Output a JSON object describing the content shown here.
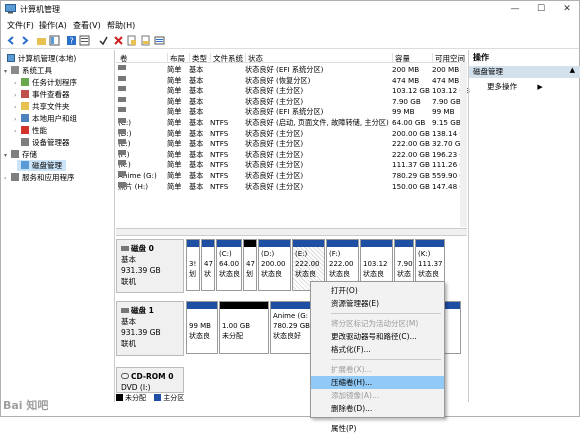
{
  "window": {
    "title": "计算机管理",
    "minimize": "—",
    "maximize": "☐",
    "close": "✕"
  },
  "menu": [
    "文件(F)",
    "操作(A)",
    "查看(V)",
    "帮助(H)"
  ],
  "tree": [
    {
      "label": "计算机管理(本地)",
      "level": 0,
      "arrow": "",
      "icon": "computer-icon"
    },
    {
      "label": "系统工具",
      "level": 1,
      "arrow": "▾",
      "icon": "tools-icon"
    },
    {
      "label": "任务计划程序",
      "level": 2,
      "arrow": "›",
      "icon": "task-scheduler-icon"
    },
    {
      "label": "事件查看器",
      "level": 2,
      "arrow": "›",
      "icon": "event-viewer-icon"
    },
    {
      "label": "共享文件夹",
      "level": 2,
      "arrow": "›",
      "icon": "shared-folder-icon"
    },
    {
      "label": "本地用户和组",
      "level": 2,
      "arrow": "›",
      "icon": "users-icon"
    },
    {
      "label": "性能",
      "level": 2,
      "arrow": "›",
      "icon": "performance-icon"
    },
    {
      "label": "设备管理器",
      "level": 2,
      "arrow": "",
      "icon": "device-manager-icon"
    },
    {
      "label": "存储",
      "level": 1,
      "arrow": "▾",
      "icon": "storage-icon"
    },
    {
      "label": "磁盘管理",
      "level": 2,
      "arrow": "",
      "icon": "disk-management-icon",
      "selected": true
    },
    {
      "label": "服务和应用程序",
      "level": 1,
      "arrow": "›",
      "icon": "services-icon"
    }
  ],
  "columns": [
    "卷",
    "布局",
    "类型",
    "文件系统",
    "状态",
    "容量",
    "可用空间"
  ],
  "volumes": [
    [
      "",
      "简单",
      "基本",
      "",
      "状态良好 (EFI 系统分区)",
      "200 MB",
      "200 MB"
    ],
    [
      "",
      "简单",
      "基本",
      "",
      "状态良好 (恢复分区)",
      "474 MB",
      "474 MB"
    ],
    [
      "",
      "简单",
      "基本",
      "",
      "状态良好 (主分区)",
      "103.12 GB",
      "103.12 GB"
    ],
    [
      "",
      "简单",
      "基本",
      "",
      "状态良好 (主分区)",
      "7.90 GB",
      "7.90 GB"
    ],
    [
      "",
      "简单",
      "基本",
      "",
      "状态良好 (EFI 系统分区)",
      "99 MB",
      "99 MB"
    ],
    [
      "(C:)",
      "简单",
      "基本",
      "NTFS",
      "状态良好 (启动, 页面文件, 故障转储, 主分区)",
      "64.00 GB",
      "9.15 GB"
    ],
    [
      "(D:)",
      "简单",
      "基本",
      "NTFS",
      "状态良好 (主分区)",
      "200.00 GB",
      "138.14 G"
    ],
    [
      "(E:)",
      "简单",
      "基本",
      "NTFS",
      "状态良好 (主分区)",
      "222.00 GB",
      "32.70 GB"
    ],
    [
      "(F:)",
      "简单",
      "基本",
      "NTFS",
      "状态良好 (主分区)",
      "222.00 GB",
      "196.23 G"
    ],
    [
      "(K:)",
      "简单",
      "基本",
      "NTFS",
      "状态良好 (主分区)",
      "111.37 GB",
      "111.26 G"
    ],
    [
      "Anime (G:)",
      "简单",
      "基本",
      "NTFS",
      "状态良好 (主分区)",
      "780.29 GB",
      "559.90 G"
    ],
    [
      "照片 (H:)",
      "简单",
      "基本",
      "NTFS",
      "状态良好 (主分区)",
      "150.00 GB",
      "147.48 G"
    ]
  ],
  "disks": [
    {
      "name": "磁盘 0",
      "type": "基本",
      "size": "931.39 GB",
      "state": "联机",
      "partitions": [
        {
          "l1": "",
          "l2": "3!",
          "l3": "划"
        },
        {
          "l1": "",
          "l2": "47",
          "l3": "状"
        },
        {
          "l1": "(C:)",
          "l2": "64.00",
          "l3": "状态良"
        },
        {
          "l1": "",
          "l2": "47",
          "l3": "划"
        },
        {
          "l1": "(D:)",
          "l2": "200.00",
          "l3": "状态良"
        },
        {
          "l1": "(E:)",
          "l2": "222.00",
          "l3": "状态良"
        },
        {
          "l1": "(F:)",
          "l2": "222.00",
          "l3": "状态良"
        },
        {
          "l1": "",
          "l2": "103.12",
          "l3": "状态良"
        },
        {
          "l1": "",
          "l2": "7.90",
          "l3": "状态"
        },
        {
          "l1": "(K:)",
          "l2": "111.37",
          "l3": "状态良"
        }
      ]
    },
    {
      "name": "磁盘 1",
      "type": "基本",
      "size": "931.39 GB",
      "state": "联机",
      "partitions": [
        {
          "l1": "",
          "l2": "99 MB",
          "l3": "状态良"
        },
        {
          "l1": "",
          "l2": "1.00 GB",
          "l3": "未分配"
        },
        {
          "l1": "Anime (G:",
          "l2": "780.29 GB",
          "l3": "状态良好"
        },
        {
          "l1": "",
          "l2": "",
          "l3": ""
        }
      ]
    },
    {
      "name": "CD-ROM 0",
      "type": "DVD (I:)",
      "size": "",
      "state": "",
      "partitions": []
    }
  ],
  "legend": [
    "未分配",
    "主分区"
  ],
  "actions": {
    "title": "操作",
    "section": "磁盘管理",
    "more": "更多操作"
  },
  "context_menu": [
    {
      "label": "打开(O)",
      "disabled": false
    },
    {
      "label": "资源管理器(E)",
      "disabled": false
    },
    {
      "sep": true
    },
    {
      "label": "将分区标记为活动分区(M)",
      "disabled": true
    },
    {
      "label": "更改驱动器号和路径(C)...",
      "disabled": false
    },
    {
      "label": "格式化(F)...",
      "disabled": false
    },
    {
      "sep": true
    },
    {
      "label": "扩展卷(X)...",
      "disabled": true
    },
    {
      "label": "压缩卷(H)...",
      "disabled": false,
      "highlight": true
    },
    {
      "label": "添加镜像(A)...",
      "disabled": true
    },
    {
      "label": "删除卷(D)...",
      "disabled": false
    },
    {
      "sep": true
    },
    {
      "label": "属性(P)",
      "disabled": false
    }
  ],
  "watermark": "Bai 知吧",
  "colors": {
    "primary": "#1f4fa3",
    "unallocated": "#000000",
    "menu_highlight": "#91c9f7",
    "selected": "#cce4f7"
  }
}
